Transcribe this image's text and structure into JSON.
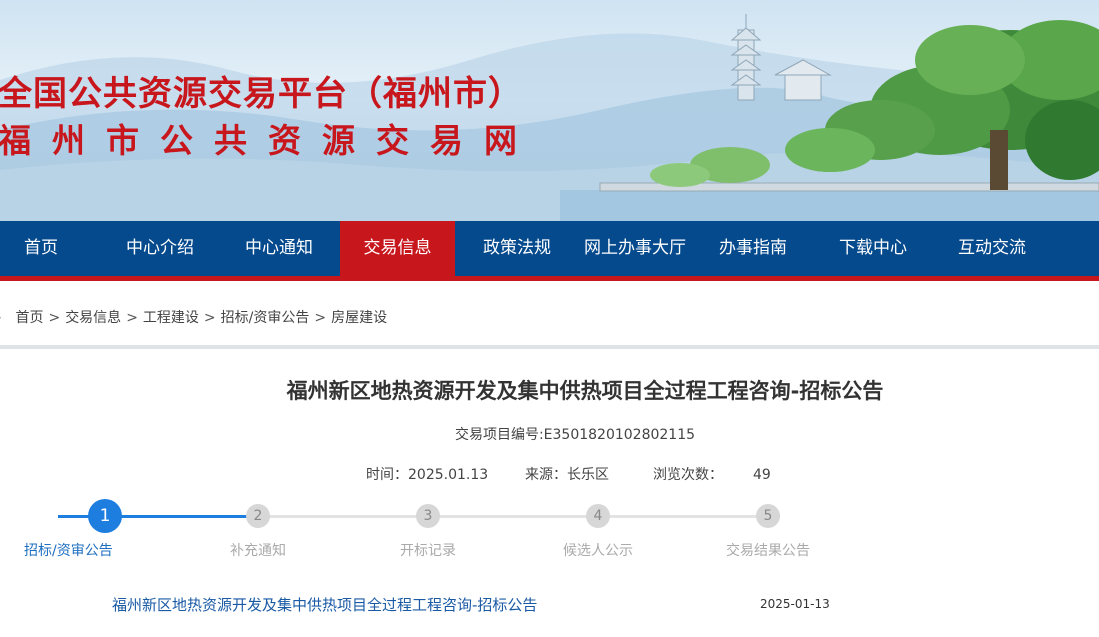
{
  "banner": {
    "title_line1": "全国公共资源交易平台（福州市）",
    "title_line2": "福州市公共资源交易网"
  },
  "nav": {
    "items": [
      {
        "label": "首页"
      },
      {
        "label": "中心介绍"
      },
      {
        "label": "中心通知"
      },
      {
        "label": "交易信息",
        "active": true
      },
      {
        "label": "政策法规"
      },
      {
        "label": "网上办事大厅"
      },
      {
        "label": "办事指南"
      },
      {
        "label": "下载中心"
      },
      {
        "label": "互动交流"
      }
    ]
  },
  "breadcrumb": {
    "items": [
      "首页",
      "交易信息",
      "工程建设",
      "招标/资审公告",
      "房屋建设"
    ],
    "separator": ">"
  },
  "article": {
    "title": "福州新区地热资源开发及集中供热项目全过程工程咨询-招标公告",
    "project_no": "交易项目编号:E3501820102802115",
    "time_label": "时间：",
    "time_value": "2025.01.13",
    "source_label": "来源：",
    "source_value": "长乐区",
    "views_label": "浏览次数：",
    "views_value": "49"
  },
  "steps": [
    {
      "num": "1",
      "label": "招标/资审公告",
      "active": true
    },
    {
      "num": "2",
      "label": "补充通知"
    },
    {
      "num": "3",
      "label": "开标记录"
    },
    {
      "num": "4",
      "label": "候选人公示"
    },
    {
      "num": "5",
      "label": "交易结果公告"
    }
  ],
  "list": [
    {
      "title": "福州新区地热资源开发及集中供热项目全过程工程咨询-招标公告",
      "date": "2025-01-13"
    }
  ],
  "colors": {
    "brand_red": "#c8161d",
    "nav_blue": "#064a8e",
    "step_blue": "#1e7ee0",
    "link_blue": "#1a5aa5"
  }
}
